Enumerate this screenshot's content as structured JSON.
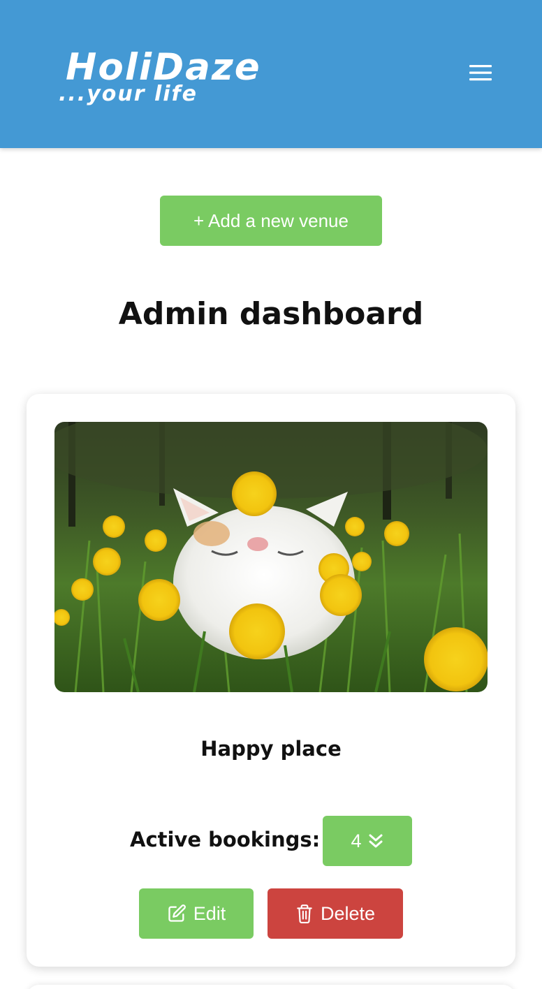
{
  "header": {
    "logo_title": "HoliDaze",
    "logo_tagline": "...your life",
    "menu_icon": "hamburger-menu-icon",
    "background_color": "#4499d4"
  },
  "actions": {
    "add_venue_label": "+ Add a new venue"
  },
  "page": {
    "title": "Admin dashboard"
  },
  "venues": [
    {
      "name": "Happy place",
      "image_subject": "white cat among yellow dandelions",
      "bookings_label": "Active bookings:",
      "bookings_count": "4",
      "bookings_icon": "chevron-double-down-icon",
      "edit_label": "Edit",
      "edit_icon": "edit-icon",
      "delete_label": "Delete",
      "delete_icon": "trash-icon"
    }
  ],
  "colors": {
    "primary_green": "#7acb62",
    "danger_red": "#cc443f"
  }
}
